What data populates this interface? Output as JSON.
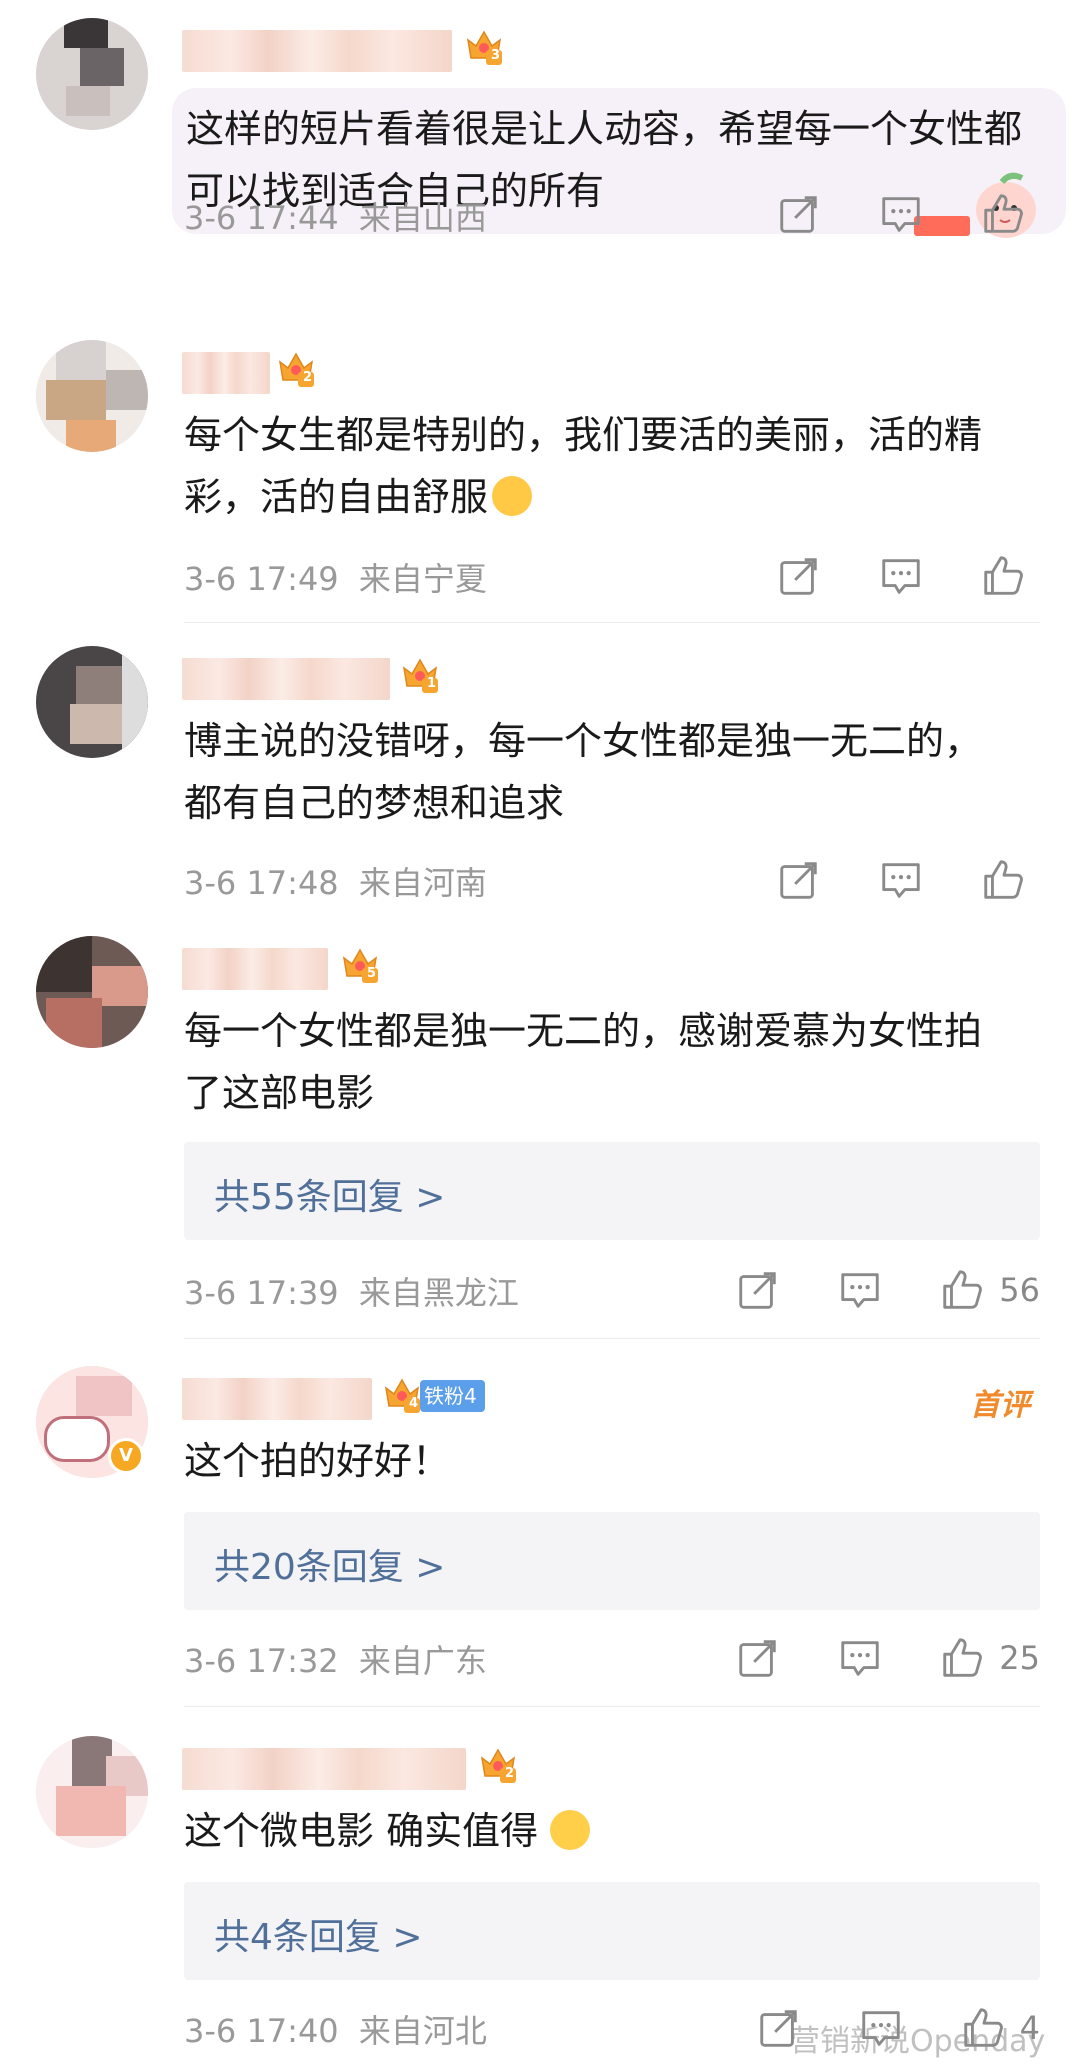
{
  "icons": {
    "share": "share-icon",
    "comment": "comment-icon",
    "like": "like-icon",
    "crown": "crown-icon",
    "verified": "verified-v-icon"
  },
  "colors": {
    "reply_link": "#50709a",
    "meta_text": "#999999",
    "first_comment_tag": "#f08a2c",
    "fan_badge": "#5b9ee9",
    "crown": "#f5a623"
  },
  "comments": [
    {
      "crown_level": "3",
      "text": "这样的短片看着很是让人动容，希望每一个女性都可以找到适合自己的所有",
      "time": "3-6 17:44",
      "location": "来自山西",
      "like_count": ""
    },
    {
      "crown_level": "2",
      "text": "每个女生都是特别的，我们要活的美丽，活的精彩，活的自由舒服",
      "time": "3-6 17:49",
      "location": "来自宁夏",
      "like_count": ""
    },
    {
      "crown_level": "1",
      "text": "博主说的没错呀，每一个女性都是独一无二的，都有自己的梦想和追求",
      "time": "3-6 17:48",
      "location": "来自河南",
      "like_count": ""
    },
    {
      "crown_level": "5",
      "text": "每一个女性都是独一无二的，感谢爱慕为女性拍了这部电影",
      "replies": "共55条回复 >",
      "time": "3-6 17:39",
      "location": "来自黑龙江",
      "like_count": "56"
    },
    {
      "crown_level": "4",
      "fan_badge": "铁粉4",
      "first_tag": "首评",
      "text": "这个拍的好好！",
      "replies": "共20条回复 >",
      "time": "3-6 17:32",
      "location": "来自广东",
      "like_count": "25"
    },
    {
      "crown_level": "2",
      "text": "这个微电影 确实值得",
      "replies": "共4条回复 >",
      "time": "3-6 17:40",
      "location": "来自河北",
      "like_count": "4"
    }
  ],
  "watermark": "营销新说Openday"
}
